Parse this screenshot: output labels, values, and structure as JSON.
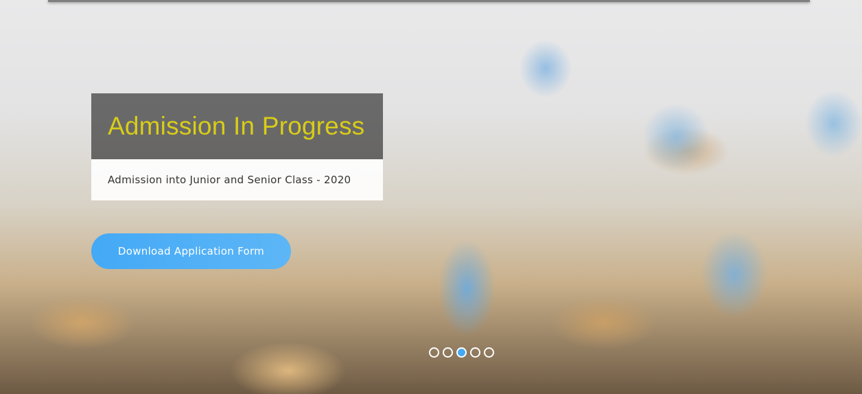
{
  "slider": {
    "title": "Admission In Progress",
    "subtitle": "Admission into Junior and Senior Class - 2020",
    "cta_label": "Download Application Form",
    "slide_count": 5,
    "active_slide": 3
  },
  "colors": {
    "title": "#d8cd18",
    "cta_background": "#44a9f6",
    "dot_active": "#45a8f2",
    "dot_border": "#ffffff"
  }
}
